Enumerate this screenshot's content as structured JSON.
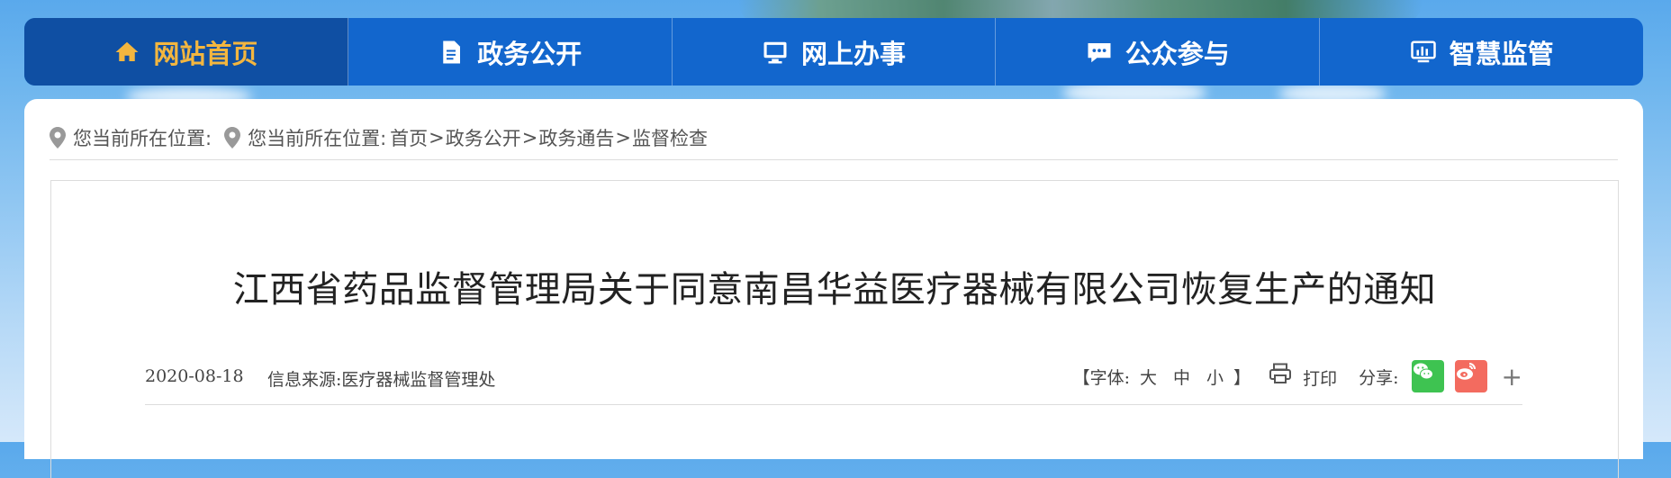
{
  "nav": {
    "items": [
      {
        "label": "网站首页",
        "icon": "home-icon",
        "active": true
      },
      {
        "label": "政务公开",
        "icon": "document-icon",
        "active": false
      },
      {
        "label": "网上办事",
        "icon": "monitor-icon",
        "active": false
      },
      {
        "label": "公众参与",
        "icon": "chat-icon",
        "active": false
      },
      {
        "label": "智慧监管",
        "icon": "chart-monitor-icon",
        "active": false
      }
    ],
    "active_color": "#f3b63f",
    "bg_color": "#1266cd"
  },
  "breadcrumb": {
    "label_outer": "您当前所在位置:",
    "label_inner": "您当前所在位置:",
    "items": [
      "首页",
      "政务公开",
      "政务通告",
      "监督检查"
    ],
    "separator": ">"
  },
  "article": {
    "title": "江西省药品监督管理局关于同意南昌华益医疗器械有限公司恢复生产的通知",
    "date": "2020-08-18",
    "source_label": "信息来源:",
    "source_value": "医疗器械监督管理处",
    "font_size": {
      "open": "【字体:",
      "large": "大",
      "medium": "中",
      "small": "小",
      "close": "】"
    },
    "print_label": "打印",
    "share_label": "分享:",
    "share_more": "+"
  }
}
